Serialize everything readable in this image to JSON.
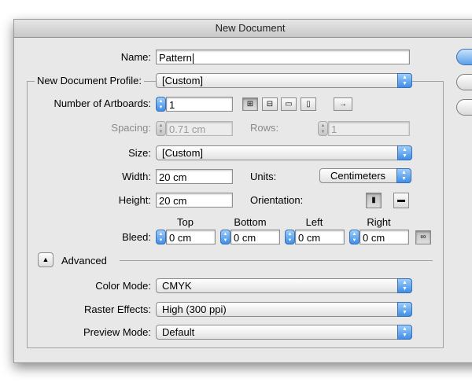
{
  "window": {
    "title": "New Document"
  },
  "name": {
    "label": "Name:",
    "value": "Pattern"
  },
  "profile": {
    "label": "New Document Profile:",
    "value": "[Custom]"
  },
  "artboards": {
    "label": "Number of Artboards:",
    "value": "1",
    "icons": [
      "grid-by-row-icon",
      "grid-by-column-icon",
      "arrange-by-row-icon",
      "arrange-by-column-icon",
      "right-to-left-arrow-icon"
    ]
  },
  "spacing": {
    "label": "Spacing:",
    "value": "0.71 cm"
  },
  "rows": {
    "label": "Rows:",
    "value": "1"
  },
  "size": {
    "label": "Size:",
    "value": "[Custom]"
  },
  "width": {
    "label": "Width:",
    "value": "20 cm"
  },
  "units": {
    "label": "Units:",
    "value": "Centimeters"
  },
  "height": {
    "label": "Height:",
    "value": "20 cm"
  },
  "orientation": {
    "label": "Orientation:",
    "selected": "portrait"
  },
  "bleed": {
    "label": "Bleed:",
    "top": {
      "label": "Top",
      "value": "0 cm"
    },
    "bottom": {
      "label": "Bottom",
      "value": "0 cm"
    },
    "left": {
      "label": "Left",
      "value": "0 cm"
    },
    "right": {
      "label": "Right",
      "value": "0 cm"
    }
  },
  "advanced": {
    "label": "Advanced",
    "expanded": true
  },
  "color_mode": {
    "label": "Color Mode:",
    "value": "CMYK"
  },
  "raster_effects": {
    "label": "Raster Effects:",
    "value": "High (300 ppi)"
  },
  "preview_mode": {
    "label": "Preview Mode:",
    "value": "Default"
  },
  "colors": {
    "accent": "#3f8ee8",
    "dialog_bg": "#e8e8e8"
  }
}
